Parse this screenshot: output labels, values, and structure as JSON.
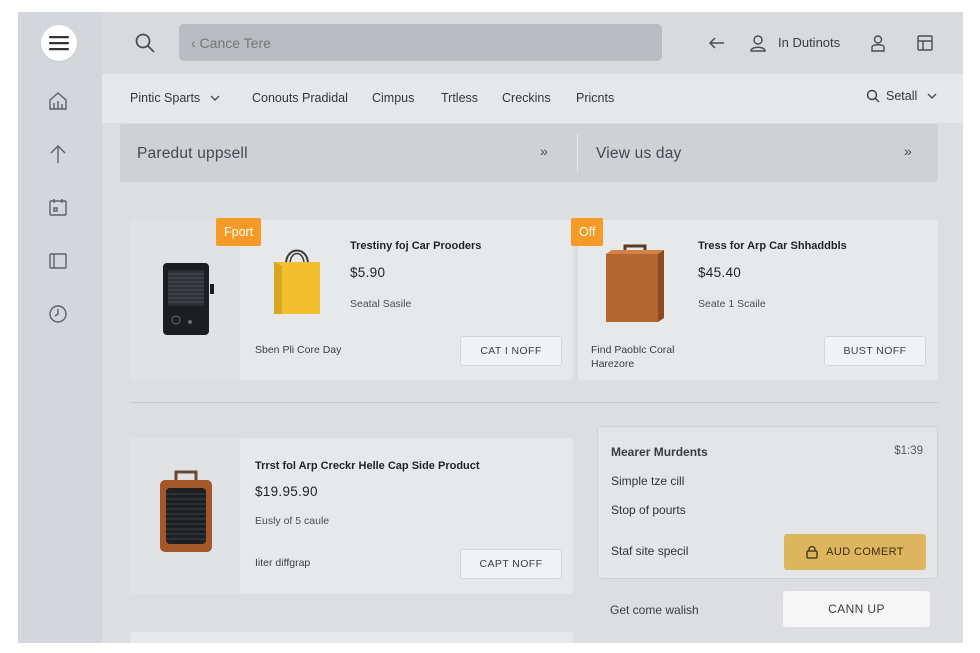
{
  "search": {
    "placeholder": "‹ Cance Tere"
  },
  "topbar": {
    "user_label": "In Dutinots"
  },
  "nav": {
    "items": [
      "Pintic Sparts",
      "Conouts Pradidal",
      "Cimpus",
      "Trtless",
      "Creckins",
      "Pricnts"
    ],
    "right_label": "Setall"
  },
  "banner": {
    "left": "Paredut uppsell",
    "right": "View us day",
    "chevron": "»"
  },
  "products": [
    {
      "badge": "Fport",
      "title": "Trestiny foj Car Prooders",
      "price": "$5.90",
      "subtitle": "Seatal Sasile",
      "footer": "Sben Pli Core Day",
      "button": "CAT I NOFF"
    },
    {
      "badge": "Off",
      "title": "Tress for Arp Car Shhaddbls",
      "price": "$45.40",
      "subtitle": "Seate 1 Scaile",
      "footer": "Find Paoblc Coral Harezore",
      "button": "BUST NOFF"
    },
    {
      "title": "Trrst fol Arp Creckr Helle Cap Side Product",
      "price": "$19.95.90",
      "subtitle": "Eusly of 5 caule",
      "footer": "Iiter diffgrap",
      "button": "CAPT NOFF"
    }
  ],
  "summary": {
    "title": "Mearer Murdents",
    "amount": "$1:39",
    "line2": "Simple tze cill",
    "line3": "Stop of pourts",
    "line4": "Staf site specil",
    "button": "AUD COMERT"
  },
  "footer": {
    "label": "Get come walish",
    "button": "CANN UP"
  },
  "colors": {
    "accent_orange": "#f59a26",
    "accent_gold": "#ddb55f"
  },
  "icons": [
    "menu-icon",
    "home-icon",
    "arrow-up-icon",
    "calendar-icon",
    "panel-icon",
    "clock-icon",
    "search-icon",
    "arrow-left-icon",
    "user-icon",
    "profile-icon",
    "grid-icon",
    "chevron-down-icon",
    "lock-icon"
  ]
}
